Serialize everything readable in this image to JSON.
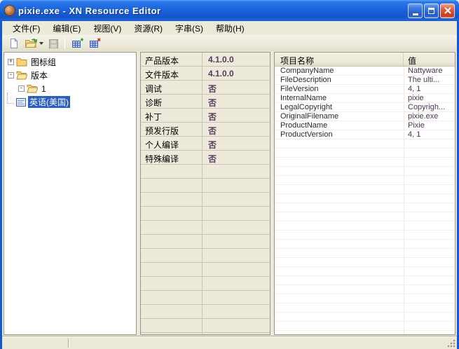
{
  "titlebar": {
    "title": "pixie.exe - XN Resource Editor",
    "app_icon": "pixie-app-icon",
    "controls": [
      {
        "name": "minimize-button",
        "icon": "minimize-icon"
      },
      {
        "name": "maximize-button",
        "icon": "maximize-icon"
      },
      {
        "name": "close-button",
        "icon": "close-icon"
      }
    ]
  },
  "menu": {
    "items": [
      "文件(F)",
      "编辑(E)",
      "视图(V)",
      "资源(R)",
      "字串(S)",
      "帮助(H)"
    ]
  },
  "toolbar": {
    "buttons": [
      {
        "name": "new-button",
        "icon": "new-document-icon",
        "enabled": true
      },
      {
        "name": "open-button",
        "icon": "open-folder-icon",
        "enabled": true,
        "has_dropdown": true
      },
      {
        "name": "save-button",
        "icon": "save-disk-icon",
        "enabled": false
      },
      {
        "name": "add-resource-button",
        "icon": "add-resource-icon",
        "enabled": true
      },
      {
        "name": "delete-resource-button",
        "icon": "delete-resource-icon",
        "enabled": true
      }
    ]
  },
  "tree": {
    "items": [
      {
        "label": "图标组",
        "state": "collapsed",
        "icon": "closed-folder-icon",
        "indent": 0,
        "selected": false
      },
      {
        "label": "版本",
        "state": "expanded",
        "icon": "open-folder-icon",
        "indent": 0,
        "selected": false
      },
      {
        "label": "1",
        "state": "expanded",
        "icon": "open-folder-icon",
        "indent": 1,
        "selected": false
      },
      {
        "label": "英语(美国)",
        "state": "leaf",
        "icon": "version-resource-icon",
        "indent": 2,
        "selected": true
      }
    ],
    "expand_collapsed_glyph": "+",
    "expand_expanded_glyph": "-"
  },
  "properties": {
    "rows": [
      {
        "label": "产品版本",
        "value": "4.1.0.0"
      },
      {
        "label": "文件版本",
        "value": "4.1.0.0"
      },
      {
        "label": "调试",
        "value": "否"
      },
      {
        "label": "诊断",
        "value": "否"
      },
      {
        "label": "补丁",
        "value": "否"
      },
      {
        "label": "预发行版",
        "value": "否"
      },
      {
        "label": "个人编译",
        "value": "否"
      },
      {
        "label": "特殊编译",
        "value": "否"
      }
    ]
  },
  "string_table": {
    "headers": {
      "name": "项目名称",
      "value": "值"
    },
    "rows": [
      {
        "name": "CompanyName",
        "value": "Nattyware"
      },
      {
        "name": "FileDescription",
        "value": "The ulti..."
      },
      {
        "name": "FileVersion",
        "value": "4, 1"
      },
      {
        "name": "InternalName",
        "value": "pixie"
      },
      {
        "name": "LegalCopyright",
        "value": "Copyrigh..."
      },
      {
        "name": "OriginalFilename",
        "value": "pixie.exe"
      },
      {
        "name": "ProductName",
        "value": "Pixie"
      },
      {
        "name": "ProductVersion",
        "value": "4, 1"
      }
    ]
  },
  "colors": {
    "titlebar_blue": "#1C63DB",
    "window_border": "#0F58D8",
    "chrome_beige": "#ECE9D8",
    "selection_blue": "#2A5CC8",
    "property_value_text": "#5A3A5A",
    "close_button_red": "#D84B24"
  }
}
